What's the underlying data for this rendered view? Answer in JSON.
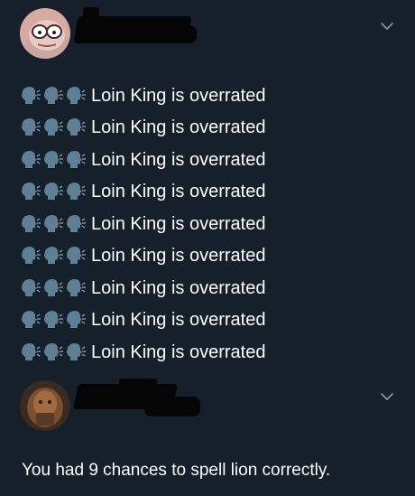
{
  "tweet": {
    "lines": [
      {
        "icons": [
          "speaking-head-icon",
          "speaking-head-icon",
          "speaking-head-icon"
        ],
        "text": "Loin King is overrated"
      },
      {
        "icons": [
          "speaking-head-icon",
          "speaking-head-icon",
          "speaking-head-icon"
        ],
        "text": "Loin King is overrated"
      },
      {
        "icons": [
          "speaking-head-icon",
          "speaking-head-icon",
          "speaking-head-icon"
        ],
        "text": "Loin King is overrated"
      },
      {
        "icons": [
          "speaking-head-icon",
          "speaking-head-icon",
          "speaking-head-icon"
        ],
        "text": "Loin King is overrated"
      },
      {
        "icons": [
          "speaking-head-icon",
          "speaking-head-icon",
          "speaking-head-icon"
        ],
        "text": "Loin King is overrated"
      },
      {
        "icons": [
          "speaking-head-icon",
          "speaking-head-icon",
          "speaking-head-icon"
        ],
        "text": "Loin King is overrated"
      },
      {
        "icons": [
          "speaking-head-icon",
          "speaking-head-icon",
          "speaking-head-icon"
        ],
        "text": "Loin King is overrated"
      },
      {
        "icons": [
          "speaking-head-icon",
          "speaking-head-icon",
          "speaking-head-icon"
        ],
        "text": "Loin King is overrated"
      },
      {
        "icons": [
          "speaking-head-icon",
          "speaking-head-icon",
          "speaking-head-icon"
        ],
        "text": "Loin King is overrated"
      }
    ]
  },
  "reply": {
    "text": "You had 9 chances to spell lion correctly."
  },
  "colors": {
    "background": "#15202b",
    "text": "#ffffff",
    "muted_icon": "#8899a6",
    "redaction": "#050505",
    "emoji_head": "#5f7f95"
  }
}
